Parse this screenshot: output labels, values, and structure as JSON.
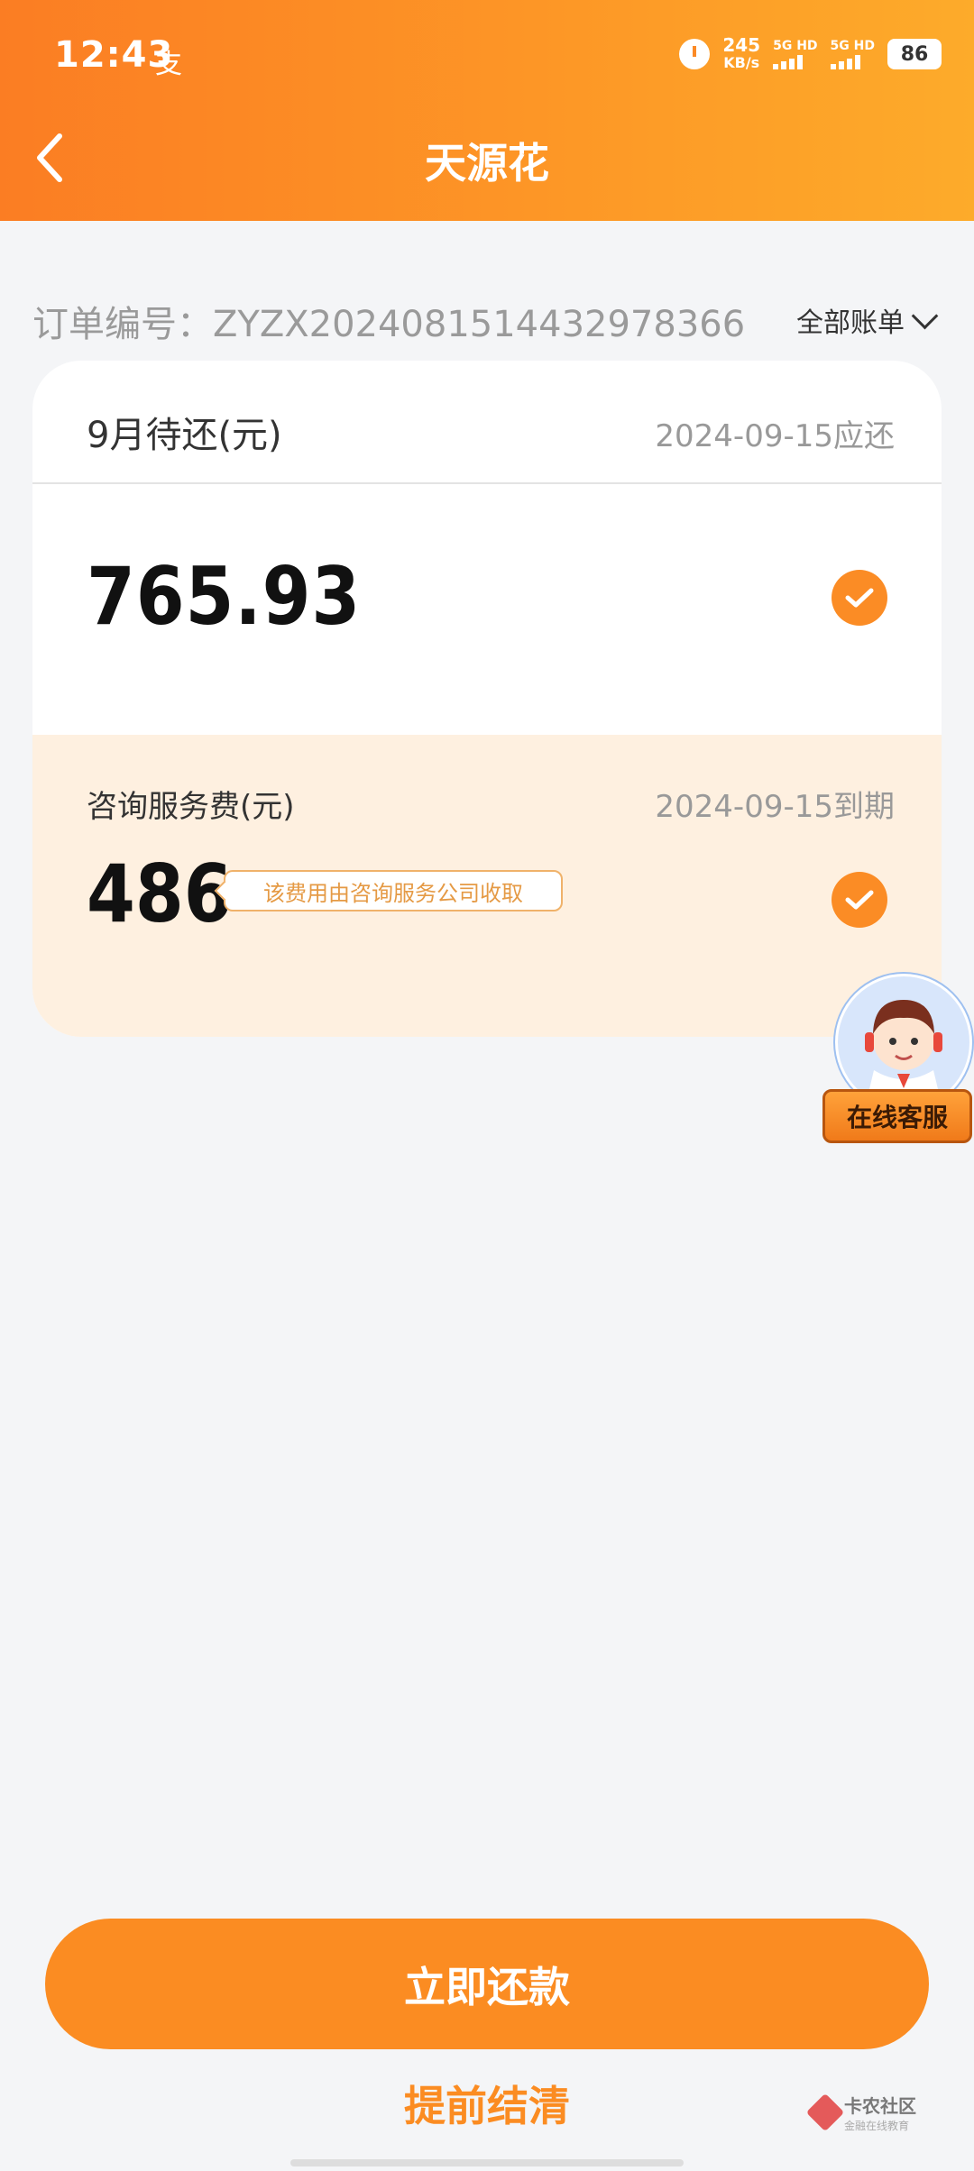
{
  "status_bar": {
    "time": "12:43",
    "app_icon": "支",
    "net_speed_value": "245",
    "net_speed_unit": "KB/s",
    "signal1_label": "5G HD",
    "signal2_label": "5G HD",
    "battery": "86"
  },
  "header": {
    "title": "天源花",
    "back_icon": "chevron-left-icon"
  },
  "order": {
    "number_text": "订单编号：ZYZX2024081514432978366",
    "all_bills_label": "全部账单"
  },
  "bill": {
    "month_label": "9月待还(元)",
    "due_date": "2024-09-15应还",
    "amount": "765.93",
    "checked": true
  },
  "fee": {
    "label": "咨询服务费(元)",
    "due_date": "2024-09-15到期",
    "amount": "486",
    "note": "该费用由咨询服务公司收取",
    "checked": true
  },
  "customer_service": {
    "label": "在线客服"
  },
  "actions": {
    "pay_now": "立即还款",
    "settle_early": "提前结清"
  },
  "watermark": {
    "main": "卡农社区",
    "sub": "金融在线教育"
  },
  "colors": {
    "accent": "#fb8c22",
    "header_start": "#fb7d23",
    "header_end": "#fdab2a",
    "fee_bg": "#fef0e0"
  }
}
